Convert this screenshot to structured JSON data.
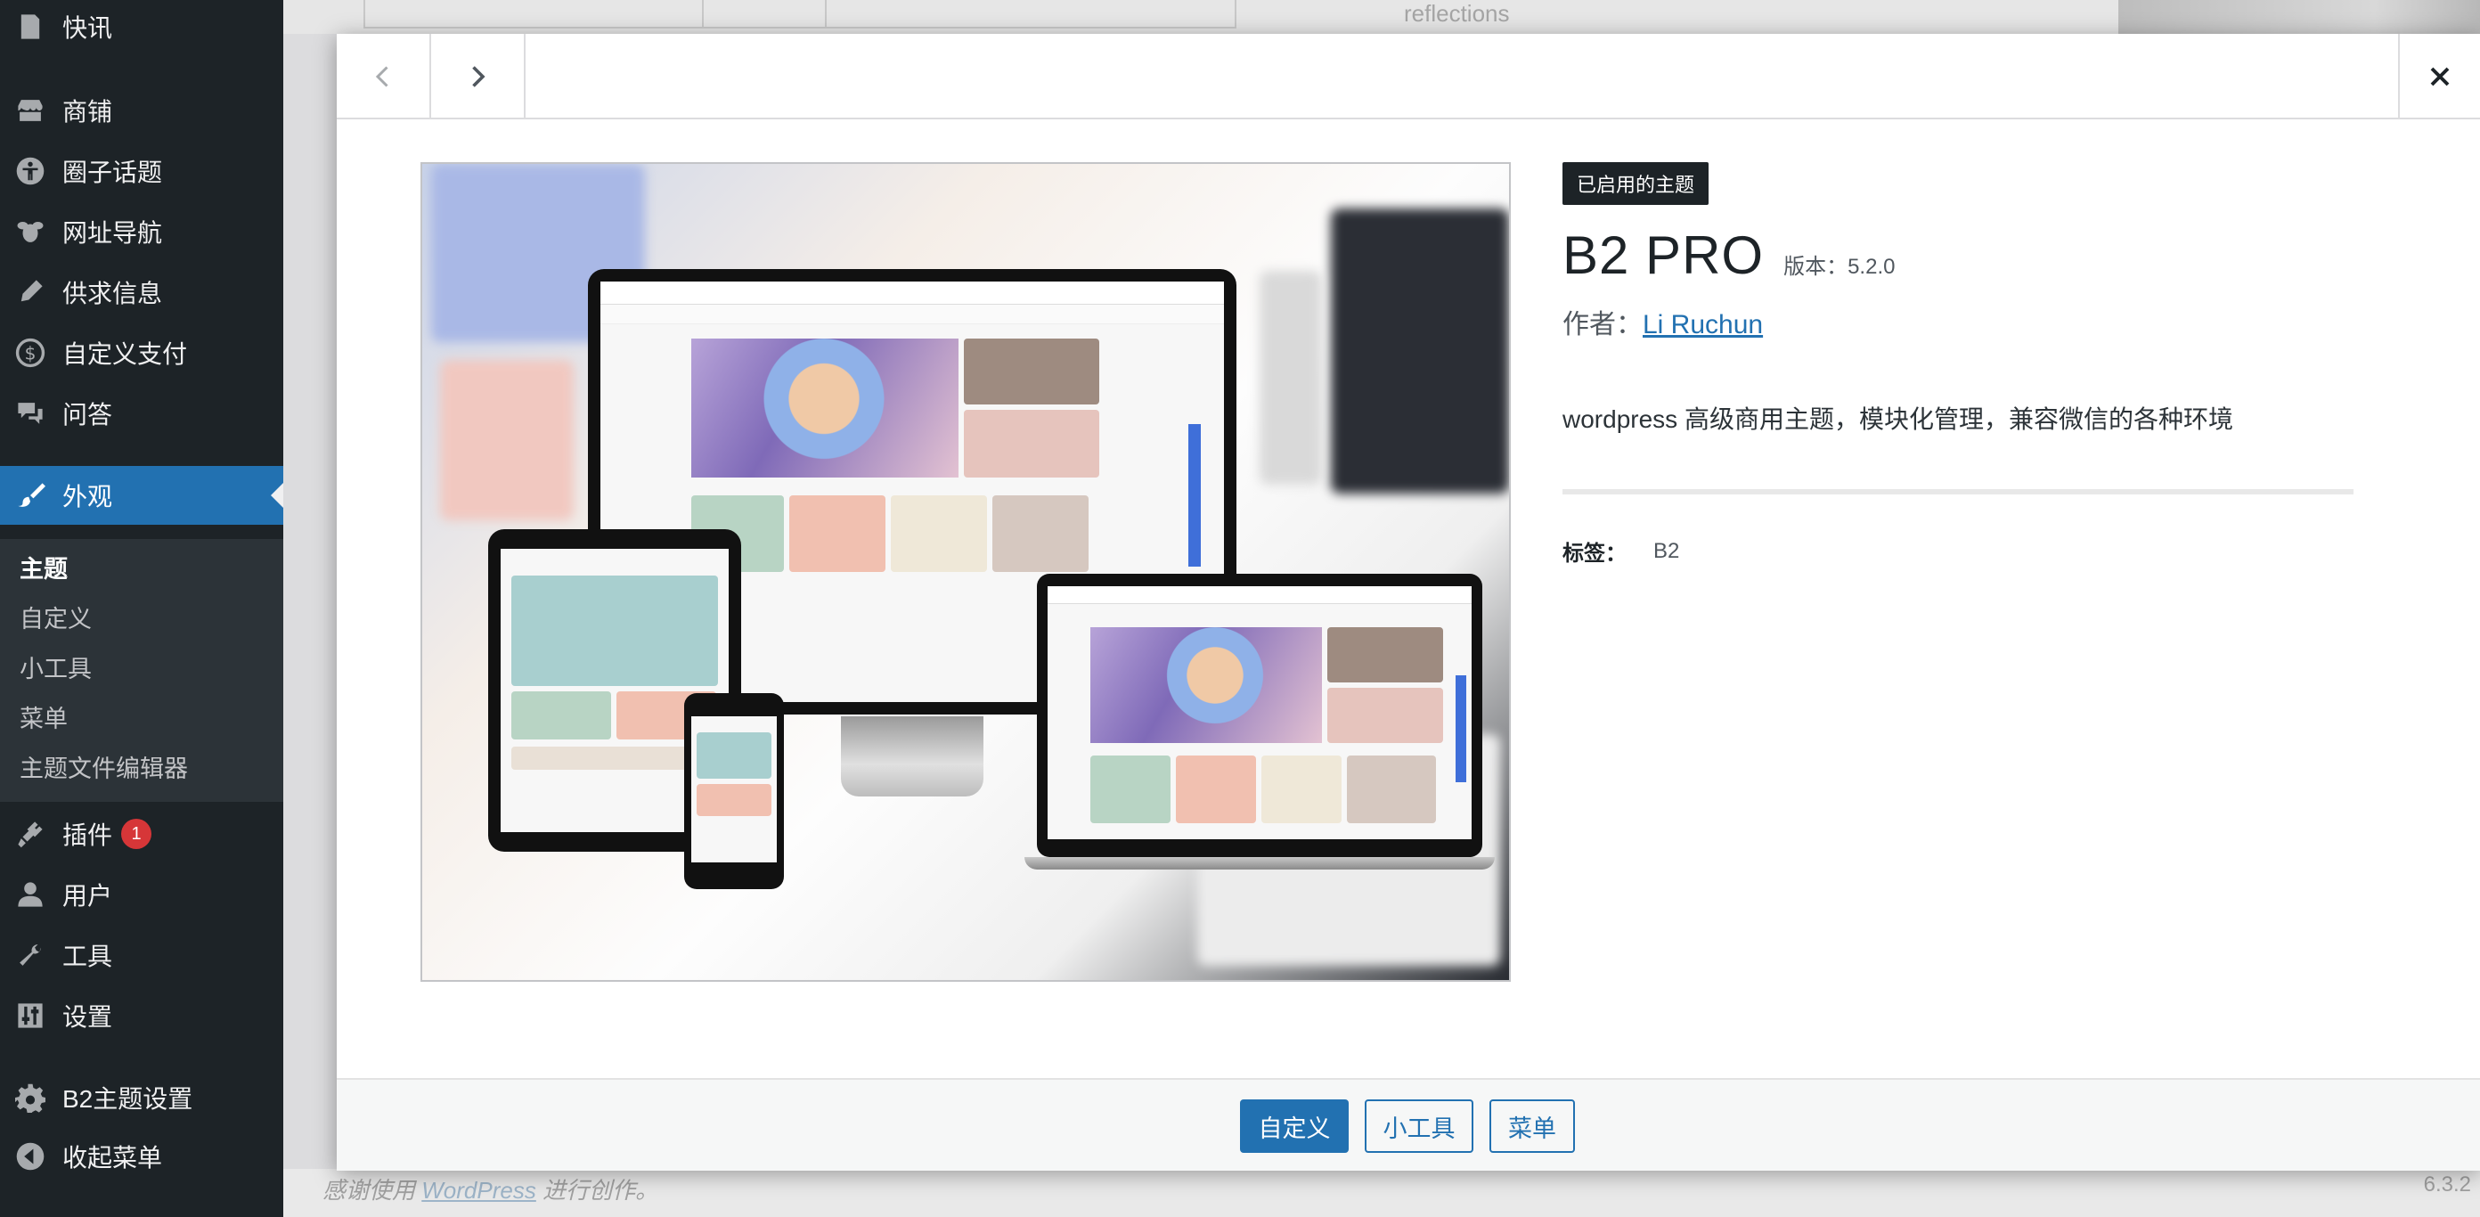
{
  "sidebar": {
    "items": [
      {
        "label": "快讯",
        "icon": "document-icon"
      },
      {
        "label": "商铺",
        "icon": "store-icon"
      },
      {
        "label": "圈子话题",
        "icon": "universal-access-icon"
      },
      {
        "label": "网址导航",
        "icon": "bee-icon"
      },
      {
        "label": "供求信息",
        "icon": "pen-icon"
      },
      {
        "label": "自定义支付",
        "icon": "dollar-icon"
      },
      {
        "label": "问答",
        "icon": "comments-icon"
      },
      {
        "label": "外观",
        "icon": "paintbrush-icon",
        "active": true
      },
      {
        "label": "插件",
        "icon": "plugin-icon",
        "badge": "1"
      },
      {
        "label": "用户",
        "icon": "user-icon"
      },
      {
        "label": "工具",
        "icon": "wrench-icon"
      },
      {
        "label": "设置",
        "icon": "settings-sliders-icon"
      },
      {
        "label": "B2主题设置",
        "icon": "gear-icon"
      },
      {
        "label": "收起菜单",
        "icon": "collapse-icon"
      }
    ],
    "submenu": [
      {
        "label": "主题",
        "current": true
      },
      {
        "label": "自定义"
      },
      {
        "label": "小工具"
      },
      {
        "label": "菜单"
      },
      {
        "label": "主题文件编辑器"
      }
    ]
  },
  "background": {
    "ghost_text": "reflections",
    "footer_prefix": "感谢使用",
    "footer_link": "WordPress",
    "footer_suffix": "进行创作。",
    "version": "6.3.2"
  },
  "modal": {
    "active_badge": "已启用的主题",
    "theme_name": "B2 PRO",
    "version_label": "版本：5.2.0",
    "author_prefix": "作者：",
    "author_name": "Li Ruchun",
    "description": "wordpress 高级商用主题，模块化管理，兼容微信的各种环境",
    "tags_label": "标签：",
    "tags_value": "B2",
    "actions": {
      "customize": "自定义",
      "widgets": "小工具",
      "menus": "菜单"
    }
  },
  "colors": {
    "sidebar_bg": "#1d2327",
    "accent": "#2271b1",
    "badge": "#d63638"
  }
}
